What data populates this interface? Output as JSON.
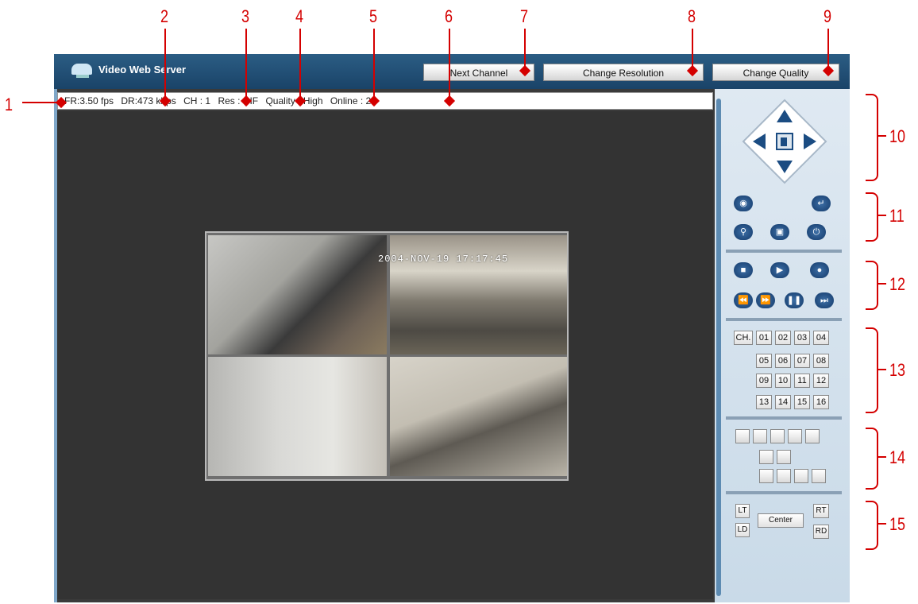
{
  "app": {
    "title": "Video Web Server",
    "next_channel_label": "Next Channel",
    "change_resolution_label": "Change Resolution",
    "change_quality_label": "Change Quality"
  },
  "status": {
    "fr": "FR:3.50 fps",
    "dr": "DR:473 kbps",
    "ch": "CH : 1",
    "res": "Res : CIF",
    "quality": "Quality : High",
    "online": "Online : 2"
  },
  "video": {
    "timestamp": "2004-NOV-19  17:17:45"
  },
  "annotations": [
    "1",
    "2",
    "3",
    "4",
    "5",
    "6",
    "7",
    "8",
    "9",
    "10",
    "11",
    "12",
    "13",
    "14",
    "15"
  ],
  "panel": {
    "channels": {
      "ch_label": "CH.",
      "rows": [
        [
          "01",
          "02",
          "03",
          "04"
        ],
        [
          "05",
          "06",
          "07",
          "08"
        ],
        [
          "09",
          "10",
          "11",
          "12"
        ],
        [
          "13",
          "14",
          "15",
          "16"
        ]
      ]
    },
    "ptz": {
      "lt": "LT",
      "rt": "RT",
      "ld": "LD",
      "rd": "RD",
      "center": "Center"
    }
  },
  "colors": {
    "titlebar": "#1f4b73",
    "annotation": "#d40000",
    "viewport": "#333333"
  }
}
